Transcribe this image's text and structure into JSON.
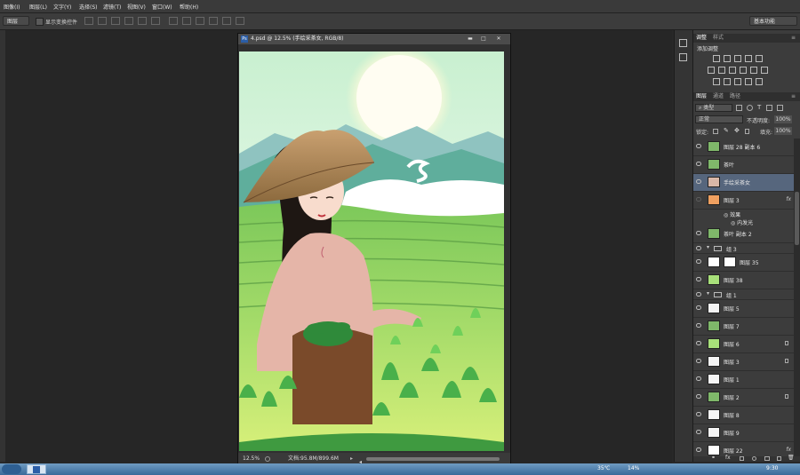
{
  "menu": [
    "图像(I)",
    "图层(L)",
    "文字(Y)",
    "选择(S)",
    "滤镜(T)",
    "视图(V)",
    "窗口(W)",
    "帮助(H)"
  ],
  "options": {
    "layer_select": "图层",
    "show_transform": "显示变换控件",
    "workspace": "基本功能"
  },
  "document": {
    "title": "4.psd @ 12.5% (手绘采茶女, RGB/8)",
    "zoom": "12.5%",
    "doc_size": "文档:95.8M/899.6M"
  },
  "adjust": {
    "tab1": "调整",
    "tab2": "样式",
    "add": "添加调整"
  },
  "layers_panel": {
    "tabs": [
      "图层",
      "通道",
      "路径"
    ],
    "filter": "类型",
    "blend_mode": "正常",
    "opacity_label": "不透明度:",
    "opacity": "100%",
    "lock_label": "锁定:",
    "fill_label": "填充:",
    "fill": "100%"
  },
  "layers": [
    {
      "name": "图层 28 副本 6",
      "type": "green"
    },
    {
      "name": "茶叶",
      "type": "green"
    },
    {
      "name": "手绘采茶女",
      "type": "girl",
      "selected": true
    },
    {
      "name": "图层 3",
      "type": "sun",
      "fx": "fx",
      "effects": [
        "效果",
        "内发光"
      ]
    },
    {
      "name": "茶叶 副本 2",
      "type": "green"
    },
    {
      "name": "组 3",
      "type": "group"
    },
    {
      "name": "图层 35",
      "type": "mask"
    },
    {
      "name": "图层 38",
      "type": "lightgreen"
    },
    {
      "name": "组 1",
      "type": "group"
    },
    {
      "name": "图层 5",
      "type": "white"
    },
    {
      "name": "图层 7",
      "type": "green"
    },
    {
      "name": "图层 6",
      "type": "lightgreen",
      "lock": true
    },
    {
      "name": "图层 3",
      "type": "white",
      "lock": true
    },
    {
      "name": "图层 1",
      "type": "white"
    },
    {
      "name": "图层 2",
      "type": "green",
      "lock": true
    },
    {
      "name": "图层 8",
      "type": "white"
    },
    {
      "name": "图层 9",
      "type": "white"
    },
    {
      "name": "图层 22",
      "type": "blank",
      "fx": "fx"
    }
  ],
  "taskbar": {
    "temp": "35℃",
    "battery": "14%",
    "clock": "9:30"
  }
}
